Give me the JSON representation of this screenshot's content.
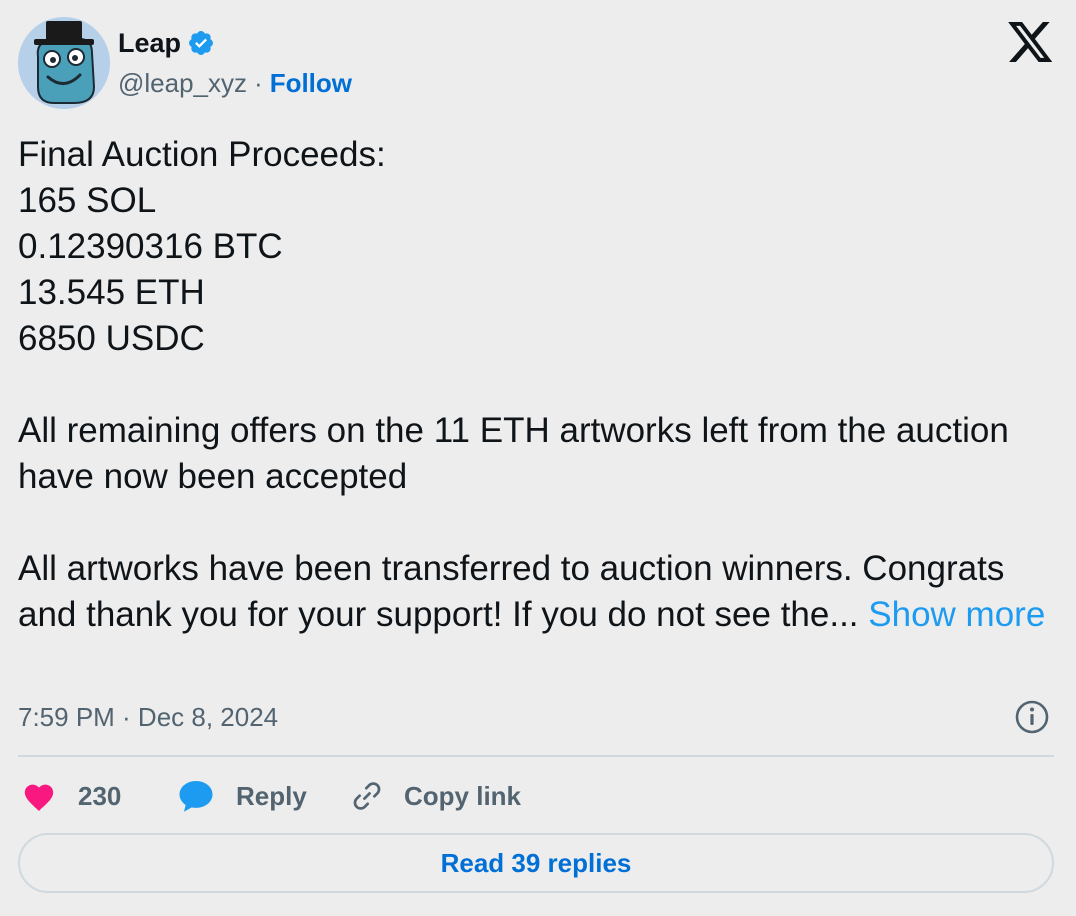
{
  "author": {
    "name": "Leap",
    "handle": "@leap_xyz",
    "separator": "·",
    "follow_label": "Follow",
    "verified_color": "#1d9bf0",
    "avatar_icon": "blue-cartoon-character-top-hat"
  },
  "tweet": {
    "lines_block1": [
      "Final Auction Proceeds:",
      "165 SOL",
      "0.12390316 BTC",
      "13.545 ETH",
      "6850 USDC"
    ],
    "paragraph2": "All remaining offers on the 11 ETH artworks left from the auction have now been accepted",
    "paragraph3": "All artworks have been transferred to auction winners. Congrats and thank you for your support! If you do not see the...",
    "show_more_label": "Show more"
  },
  "meta": {
    "timestamp": "7:59 PM · Dec 8, 2024",
    "info_icon": "info-icon"
  },
  "actions": {
    "like_count": "230",
    "like_color": "#f91880",
    "reply_label": "Reply",
    "reply_color": "#1d9bf0",
    "copy_link_label": "Copy link"
  },
  "footer": {
    "read_replies_label": "Read 39 replies"
  },
  "brand": {
    "logo": "x-logo"
  }
}
